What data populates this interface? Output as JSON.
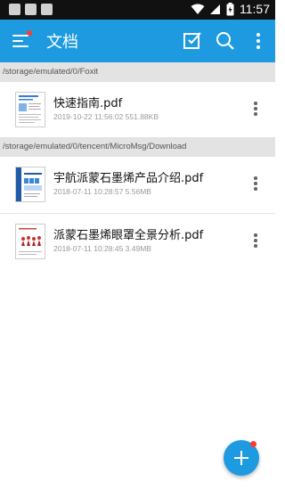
{
  "status_bar": {
    "time": "11:57",
    "battery_icon": "battery-charging-icon",
    "wifi_icon": "wifi-icon",
    "signal_icon": "signal-icon"
  },
  "app_bar": {
    "title": "文档",
    "menu_icon": "hamburger-menu-icon",
    "select_icon": "checkbox-select-icon",
    "search_icon": "search-icon",
    "overflow_icon": "more-vertical-icon",
    "accent_color": "#1e9be0",
    "notification_dot_color": "#ff3b30"
  },
  "sections": [
    {
      "path": "/storage/emulated/0/Foxit",
      "files": [
        {
          "name": "快速指南.pdf",
          "meta": "2019-10-22 11:56:02 551.88KB"
        }
      ]
    },
    {
      "path": "/storage/emulated/0/tencent/MicroMsg/Download",
      "files": [
        {
          "name": "宇航派蒙石墨烯产品介绍.pdf",
          "meta": "2018-07-11 10:28:57 5.56MB"
        },
        {
          "name": "派蒙石墨烯眼罩全景分析.pdf",
          "meta": "2018-07-11 10:28:45 3.49MB"
        }
      ]
    }
  ],
  "fab": {
    "icon": "plus-icon"
  }
}
